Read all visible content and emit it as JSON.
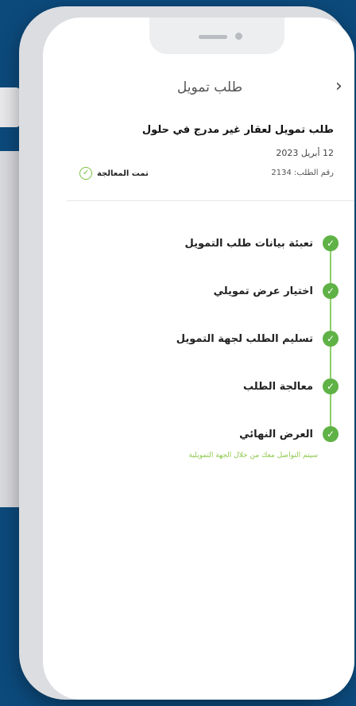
{
  "header": {
    "title": "طلب تمويل",
    "back_icon": "chevron-right-icon"
  },
  "request": {
    "title": "طلب تمويل لعقار غير مدرج في حلول",
    "date": "12 أبريل 2023",
    "number_label": "رقم الطلب: 2134",
    "status": "تمت المعالجة"
  },
  "steps": [
    {
      "label": "تعبئة بيانات طلب التمويل"
    },
    {
      "label": "اختيار عرض تمويلي"
    },
    {
      "label": "تسليم الطلب لجهة التمويل"
    },
    {
      "label": "معالجة الطلب"
    },
    {
      "label": "العرض النهائي"
    }
  ],
  "final_note": "سيتم التواصل معك من خلال الجهة التمويلية",
  "colors": {
    "accent": "#5fb246",
    "background": "#0c4a7c"
  }
}
